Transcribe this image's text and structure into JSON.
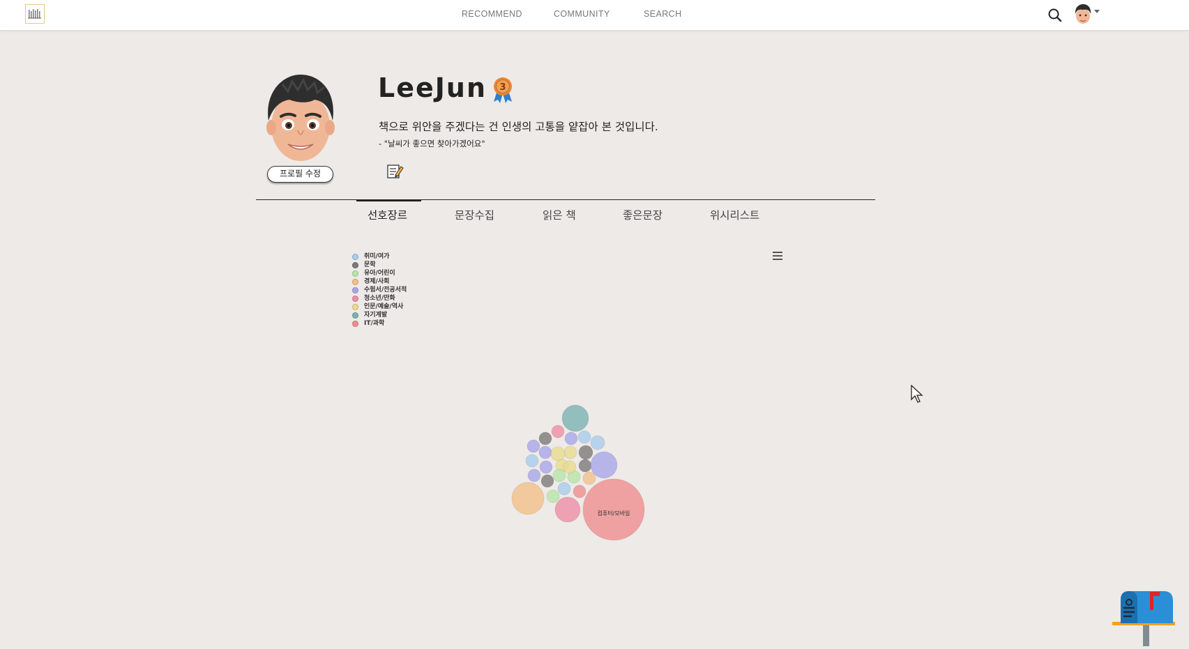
{
  "nav": {
    "items": [
      "RECOMMEND",
      "COMMUNITY",
      "SEARCH"
    ]
  },
  "profile": {
    "username": "LeeJun",
    "badge_number": "3",
    "bio": "책으로 위안을 주겠다는 건 인생의 고통을 얕잡아 본 것입니다.",
    "quote": "- \"날씨가 좋으면 찾아가겠어요\"",
    "edit_button": "프로필 수정"
  },
  "tabs": [
    {
      "label": "선호장르",
      "active": true
    },
    {
      "label": "문장수집",
      "active": false
    },
    {
      "label": "읽은 책",
      "active": false
    },
    {
      "label": "좋은문장",
      "active": false
    },
    {
      "label": "위시리스트",
      "active": false
    }
  ],
  "colors": {
    "page_bg": "#eeeae7",
    "accent_mailbox": "#2a8fd6"
  },
  "chart_data": {
    "type": "packed-bubble",
    "legend_placement": "top-left",
    "series": [
      {
        "name": "취미/여가",
        "color": "#a9cdec"
      },
      {
        "name": "문학",
        "color": "#7a7a7a"
      },
      {
        "name": "유아/어린이",
        "color": "#b7e6a8"
      },
      {
        "name": "경제/사회",
        "color": "#f2c08a"
      },
      {
        "name": "수험서/전공서적",
        "color": "#a9a6ea"
      },
      {
        "name": "청소년/만화",
        "color": "#ee8fa6"
      },
      {
        "name": "인문/예술/역사",
        "color": "#e8dc8e"
      },
      {
        "name": "자기계발",
        "color": "#7bb3b3"
      },
      {
        "name": "IT/과학",
        "color": "#ee8e8e"
      }
    ],
    "labeled_bubble": "컴퓨터/모바일"
  }
}
